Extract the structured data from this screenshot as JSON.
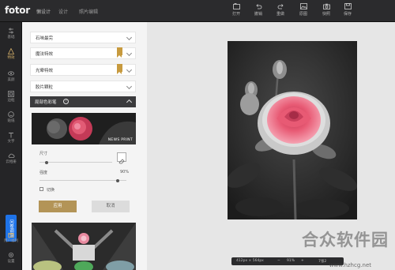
{
  "app": {
    "logo": "fotor",
    "logo_sub": "懒设计",
    "nav": [
      "设计",
      "照片编辑"
    ]
  },
  "toolbar": {
    "open_label": "打开",
    "undo_label": "撤销",
    "redo_label": "重做",
    "compare_label": "原图",
    "share_label": "快照",
    "save_label": "保存"
  },
  "rail": {
    "items": [
      "基础",
      "特效",
      "美颜",
      "边框",
      "贴纸",
      "文字",
      "云相册",
      "用户福利",
      "设置"
    ],
    "survey": "问卷调查"
  },
  "panel": {
    "accordion": [
      {
        "label": "石味最完"
      },
      {
        "label": "魔法特效"
      },
      {
        "label": "光晕特效"
      },
      {
        "label": "胶片颗粒"
      }
    ],
    "section_title": "局部色彩笔",
    "preset_caption": "NEWS PRINT",
    "size_label": "尺寸",
    "strength_label": "强度",
    "strength_value": "90%",
    "toggle_label": "切换",
    "apply_label": "应用",
    "cancel_label": "取消",
    "size_value": 0.1,
    "strength_fraction": 0.9
  },
  "status": {
    "dimensions": "412px × 564px",
    "zoom": "91%",
    "third": "7张2"
  },
  "watermark": {
    "text": "合众软件园",
    "url": "www.hzhcg.net"
  },
  "colors": {
    "accent_gold": "#b39457",
    "survey_blue": "#1e73e8",
    "rose": "#e85a74"
  }
}
